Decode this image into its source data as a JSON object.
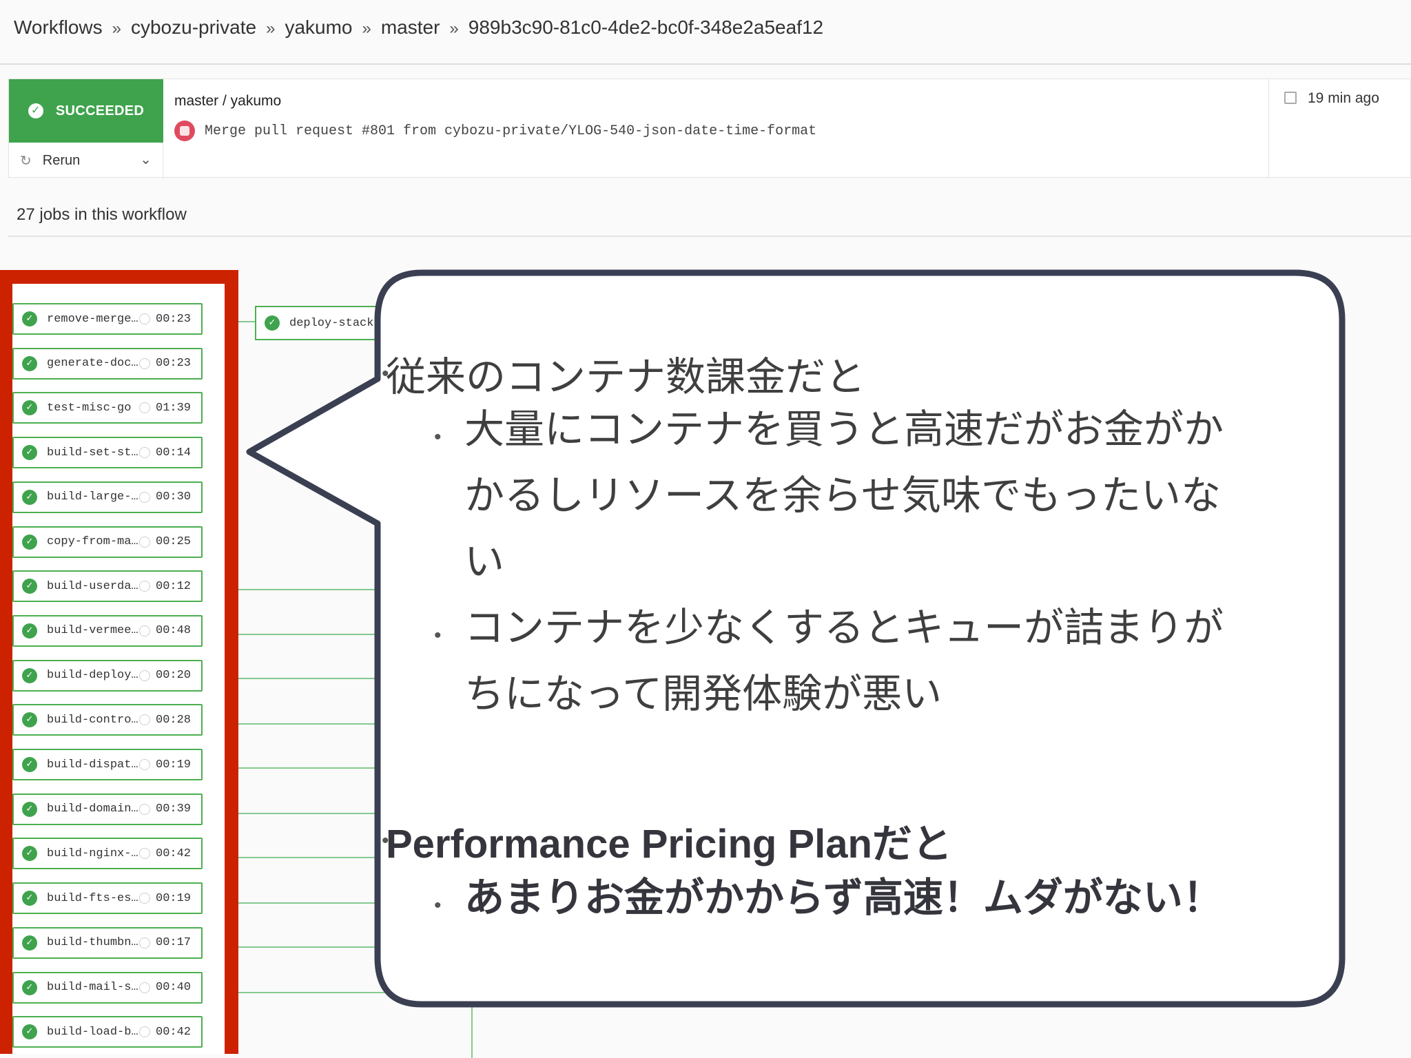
{
  "breadcrumb": [
    "Workflows",
    "cybozu-private",
    "yakumo",
    "master",
    "989b3c90-81c0-4de2-bc0f-348e2a5eaf12"
  ],
  "breadcrumb_separator": "»",
  "status": {
    "label": "SUCCEEDED",
    "color": "#3fa34d"
  },
  "rerun_label": "Rerun",
  "branch_label": "master / yakumo",
  "commit_message": "Merge pull request #801 from cybozu-private/YLOG-540-json-date-time-format",
  "time_ago": "19 min ago",
  "jobs_count_text": "27 jobs in this workflow",
  "jobs": [
    {
      "name": "remove-merge…",
      "duration": "00:23"
    },
    {
      "name": "generate-doc…",
      "duration": "00:23"
    },
    {
      "name": "test-misc-go",
      "duration": "01:39"
    },
    {
      "name": "build-set-st…",
      "duration": "00:14"
    },
    {
      "name": "build-large-…",
      "duration": "00:30"
    },
    {
      "name": "copy-from-ma…",
      "duration": "00:25"
    },
    {
      "name": "build-userda…",
      "duration": "00:12"
    },
    {
      "name": "build-vermee…",
      "duration": "00:48"
    },
    {
      "name": "build-deploy…",
      "duration": "00:20"
    },
    {
      "name": "build-contro…",
      "duration": "00:28"
    },
    {
      "name": "build-dispat…",
      "duration": "00:19"
    },
    {
      "name": "build-domain…",
      "duration": "00:39"
    },
    {
      "name": "build-nginx-…",
      "duration": "00:42"
    },
    {
      "name": "build-fts-es…",
      "duration": "00:19"
    },
    {
      "name": "build-thumbn…",
      "duration": "00:17"
    },
    {
      "name": "build-mail-s…",
      "duration": "00:40"
    },
    {
      "name": "build-load-b…",
      "duration": "00:42"
    }
  ],
  "deploy_job": "deploy-stack",
  "callout": {
    "section1_title": "従来のコンテナ数課金だと",
    "section1_items": [
      [
        "大量にコンテナを買うと高速だがお金がか",
        "かるしリソースを余らせ気味でもったいな",
        "い"
      ],
      [
        "コンテナを少なくするとキューが詰まりが",
        "ちになって開発体験が悪い"
      ]
    ],
    "section2_title": "Performance Pricing Planだと",
    "section2_items": [
      "あまりお金がかからず高速！ムダがない！"
    ]
  },
  "colors": {
    "frame_red": "#cc2200",
    "success_green": "#3fa34d",
    "callout_border": "#3b3f52"
  }
}
